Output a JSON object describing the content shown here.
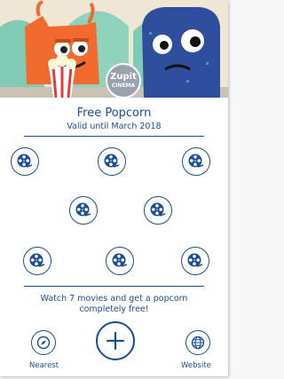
{
  "hero": {
    "logo_line1": "Zupit",
    "logo_line2": "CINEMA"
  },
  "offer": {
    "title": "Free Popcorn",
    "valid_until": "Valid until March 2018"
  },
  "stamps": {
    "count": 8,
    "icon": "film-reel-icon"
  },
  "promo": {
    "text": "Watch 7 movies and get a popcorn completely free!"
  },
  "actions": {
    "nearest_label": "Nearest",
    "nearest_icon": "compass-icon",
    "add_icon": "plus-icon",
    "website_label": "Website",
    "website_icon": "globe-icon"
  },
  "colors": {
    "accent": "#1a4d93",
    "monster_orange": "#f26a2e",
    "monster_blue": "#2f4f9e"
  }
}
